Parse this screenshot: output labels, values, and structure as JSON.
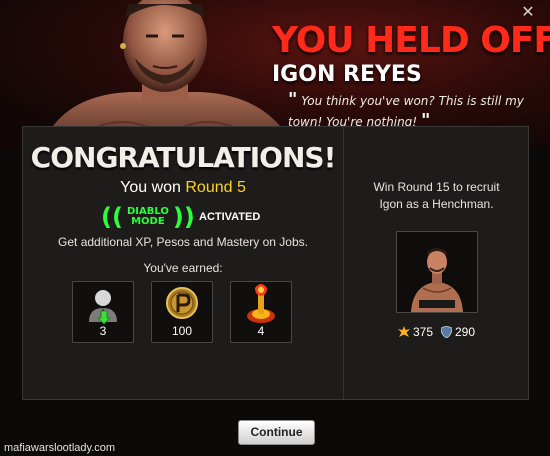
{
  "header": {
    "title_line1": "YOU HELD OFF",
    "title_line2": "IGON REYES",
    "quote": "You think you've won? This is still my town! You're nothing!",
    "quote_open": "\"",
    "quote_close": "\""
  },
  "congrats": {
    "heading": "CONGRATULATIONS!",
    "won_prefix": "You won ",
    "won_round": "Round 5",
    "diablo_line1": "DIABLO",
    "diablo_line2": "MODE",
    "activated": "ACTIVATED",
    "bonus_text": "Get additional XP, Pesos and Mastery on Jobs.",
    "earned_label": "You've earned:"
  },
  "rewards": [
    {
      "icon": "mafia-member-icon",
      "value": "3"
    },
    {
      "icon": "peso-coin-icon",
      "value": "100"
    },
    {
      "icon": "molotov-icon",
      "value": "4"
    }
  ],
  "henchman": {
    "recruit_text": "Win Round 15 to recruit Igon as a Henchman.",
    "attack": "375",
    "defense": "290"
  },
  "buttons": {
    "continue": "Continue"
  },
  "watermark": "mafiawarslootlady.com",
  "colors": {
    "title_red": "#ff2a1a",
    "highlight_yellow": "#ffd21f",
    "diablo_green": "#2aff3a"
  }
}
